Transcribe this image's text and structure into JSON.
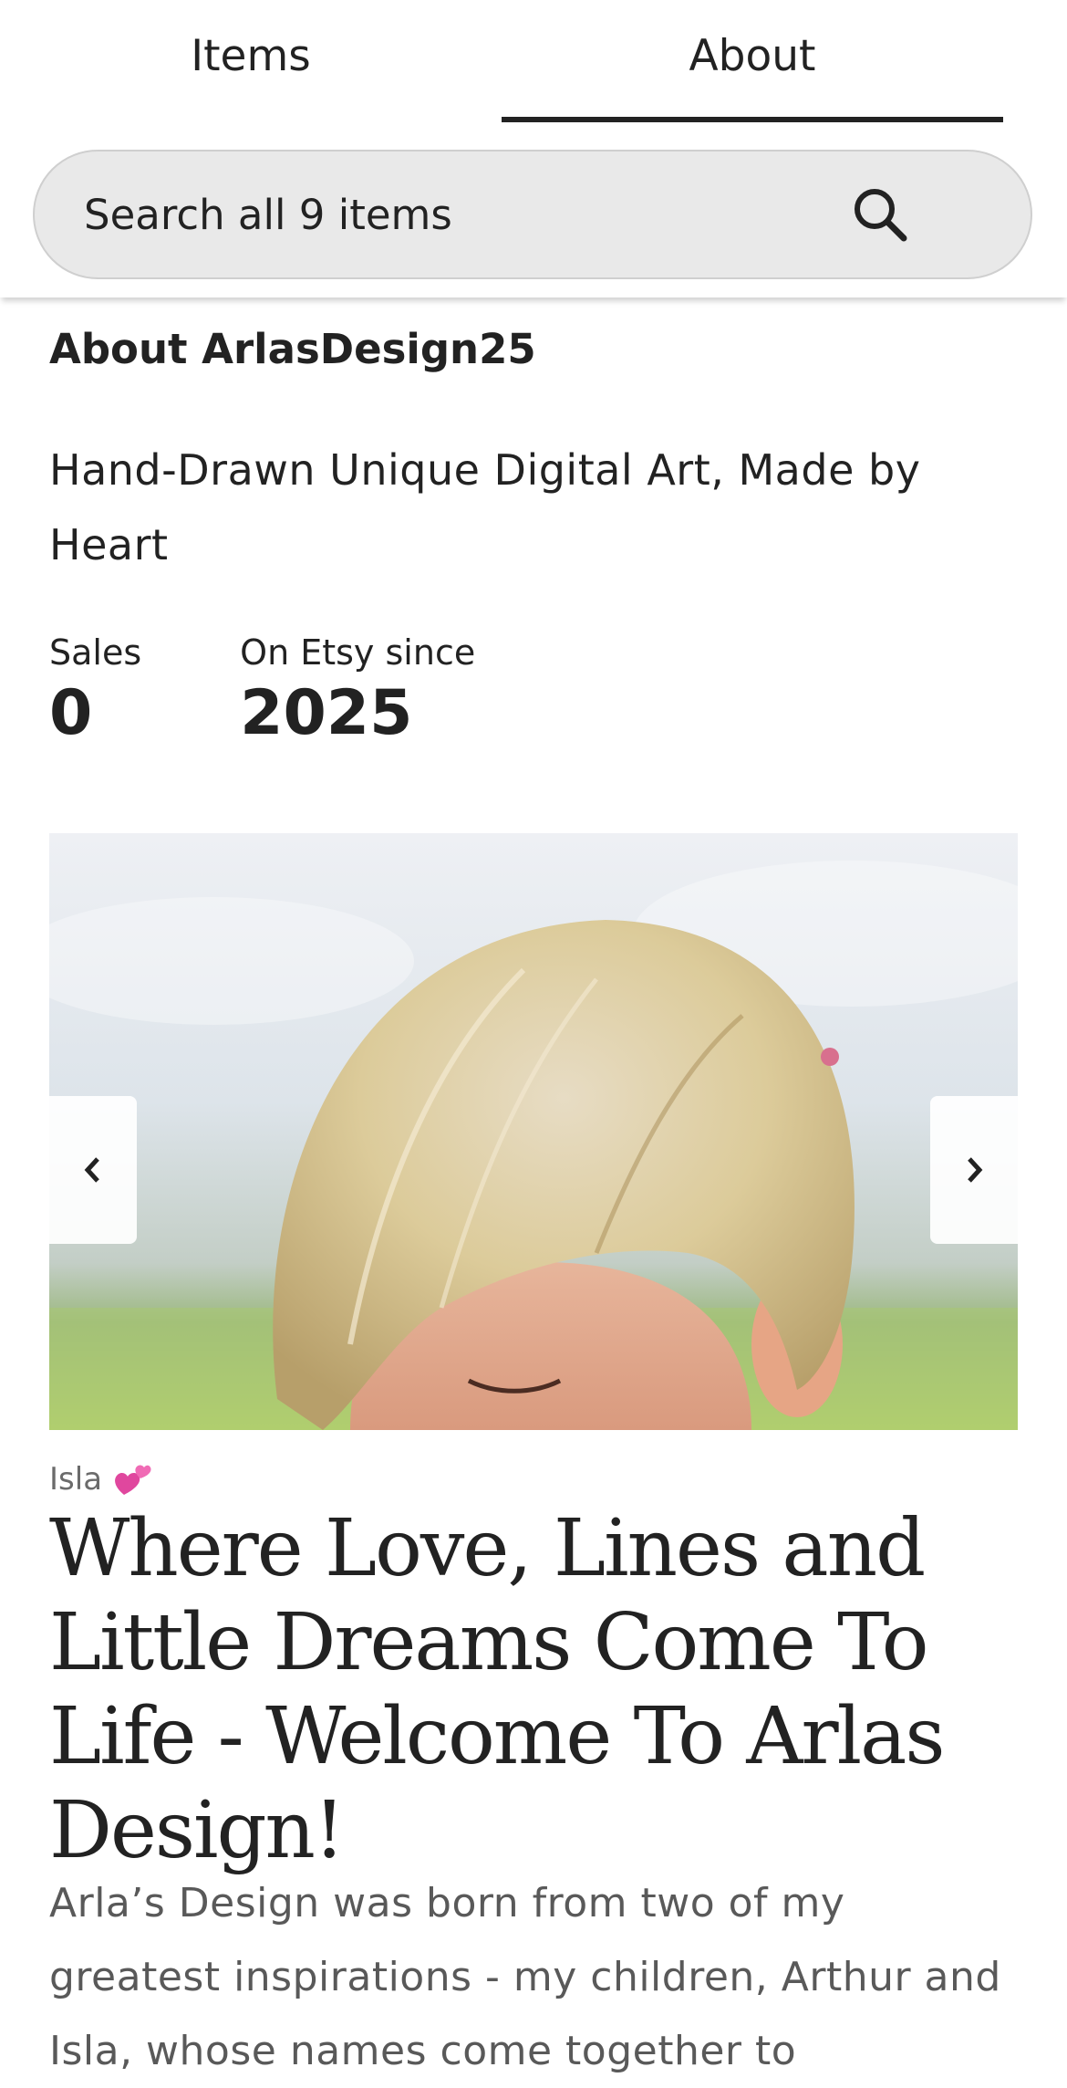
{
  "tabs": [
    {
      "label": "Items",
      "active": false
    },
    {
      "label": "About",
      "active": true
    }
  ],
  "search": {
    "placeholder": "Search all 9 items",
    "icon": "search-icon"
  },
  "about": {
    "heading": "About ArlasDesign25",
    "tagline": "Hand-Drawn Unique Digital Art, Made by Heart",
    "stats": [
      {
        "label": "Sales",
        "value": "0"
      },
      {
        "label": "On Etsy since",
        "value": "2025"
      }
    ]
  },
  "carousel": {
    "prev_icon": "chevron-left-icon",
    "next_icon": "chevron-right-icon"
  },
  "story": {
    "caption": "Isla",
    "caption_icon": "two-hearts-icon",
    "title": "Where Love, Lines and Little Dreams Come To Life - Welcome To Arlas Design!",
    "body": "Arla’s Design was born from two of my greatest inspirations - my children, Arthur and Isla, whose names come together to"
  },
  "colors": {
    "text": "#222222",
    "muted": "#595959",
    "search_bg": "#e9e9e9",
    "heart": "#e0479e"
  }
}
